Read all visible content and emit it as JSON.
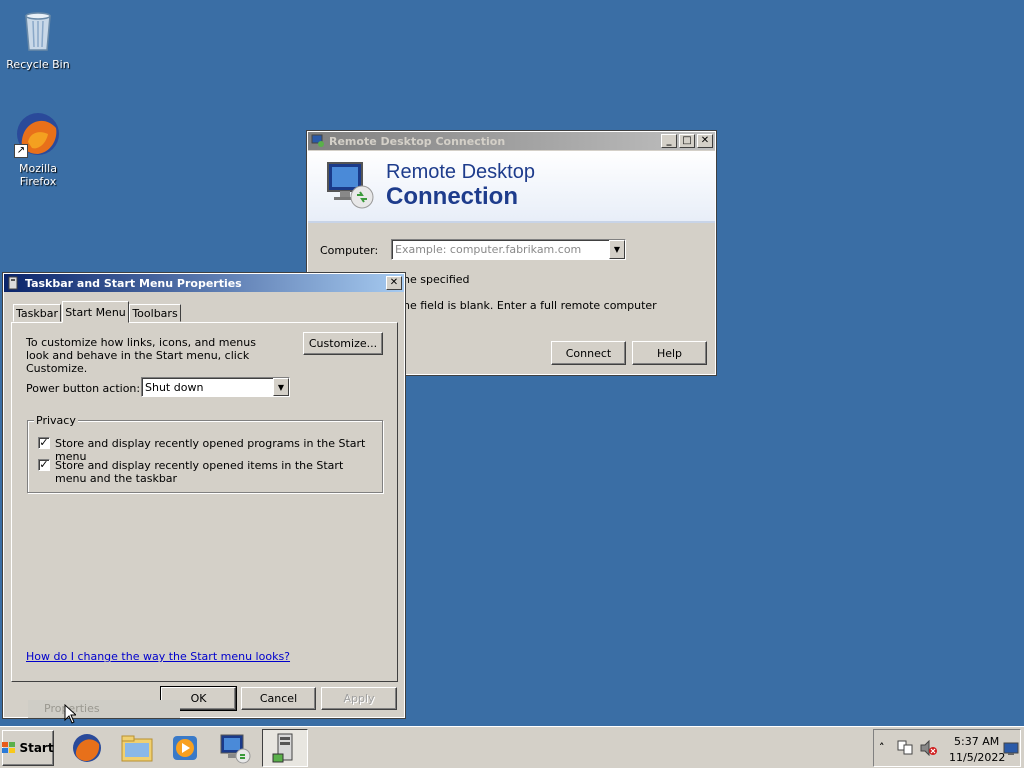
{
  "desktop": {
    "icons": [
      {
        "label": "Recycle Bin"
      },
      {
        "label": "Mozilla Firefox"
      }
    ]
  },
  "rdc": {
    "title": "Remote Desktop Connection",
    "banner_line1": "Remote Desktop",
    "banner_line2": "Connection",
    "computer_label": "Computer:",
    "computer_placeholder": "Example: computer.fabrikam.com",
    "info_line1": "he specified",
    "info_line2": "he field is blank. Enter a full remote computer",
    "connect_label": "Connect",
    "help_label": "Help"
  },
  "taskbar_props": {
    "title": "Taskbar and Start Menu Properties",
    "tabs": [
      {
        "label": "Taskbar"
      },
      {
        "label": "Start Menu"
      },
      {
        "label": "Toolbars"
      }
    ],
    "intro_text": "To customize how links, icons, and menus look and behave in the Start menu, click Customize.",
    "customize_label": "Customize...",
    "power_label": "Power button action:",
    "power_value": "Shut down",
    "privacy_label": "Privacy",
    "check1_label": "Store and display recently opened programs in the Start menu",
    "check2_label": "Store and display recently opened items in the Start menu and the taskbar",
    "help_link": "How do I change the way the Start menu looks?",
    "ok_label": "OK",
    "cancel_label": "Cancel",
    "apply_label": "Apply",
    "ghost_label": "Properties"
  },
  "taskbar": {
    "start_label": "Start",
    "time": "5:37 AM",
    "date": "11/5/2022"
  },
  "colors": {
    "desktop": "#3a6ea5",
    "banner_text": "#1e3c8c",
    "link": "#0000cc"
  }
}
